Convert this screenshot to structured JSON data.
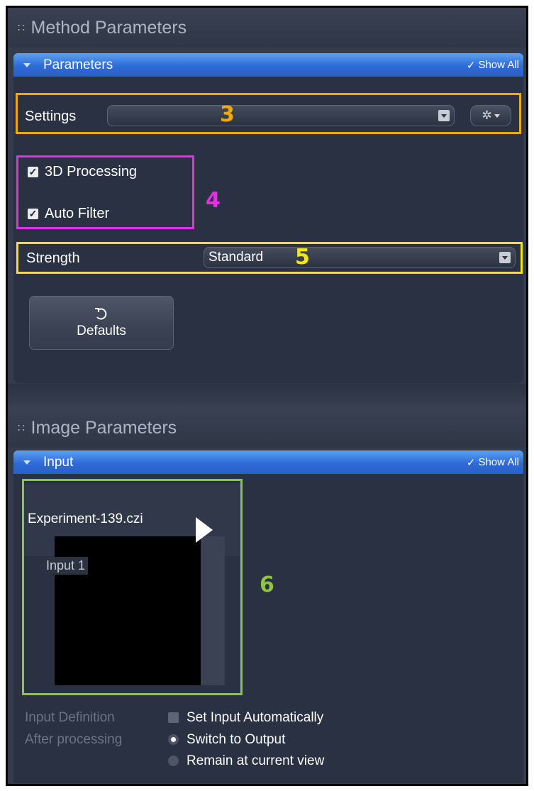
{
  "method_section": {
    "title": "Method Parameters"
  },
  "parameters_group": {
    "title": "Parameters",
    "show_all": "Show All"
  },
  "settings": {
    "label": "Settings",
    "value": ""
  },
  "checkboxes": [
    {
      "label": "3D Processing",
      "checked": true
    },
    {
      "label": "Auto Filter",
      "checked": true
    }
  ],
  "strength": {
    "label": "Strength",
    "value": "Standard"
  },
  "defaults_button": {
    "label": "Defaults"
  },
  "image_section": {
    "title": "Image Parameters"
  },
  "input_group": {
    "title": "Input",
    "show_all": "Show All"
  },
  "input_thumb": {
    "filename": "Experiment-139.czi",
    "tag": "Input 1"
  },
  "input_definition": {
    "label": "Input Definition",
    "option": "Set Input Automatically",
    "checked": false
  },
  "after_processing": {
    "label": "After processing",
    "options": [
      {
        "label": "Switch to Output",
        "selected": true
      },
      {
        "label": "Remain at current view",
        "selected": false
      }
    ]
  },
  "annotations": [
    {
      "number": "3",
      "color": "#f5a800"
    },
    {
      "number": "4",
      "color": "#e62ee6"
    },
    {
      "number": "5",
      "color": "#f5e800"
    },
    {
      "number": "6",
      "color": "#8ec63f"
    }
  ],
  "colors": {
    "panel_bg": "#343b4c",
    "group_bar": "#2e6bd7",
    "text": "#ffffff",
    "dim_text": "#6b7487"
  }
}
